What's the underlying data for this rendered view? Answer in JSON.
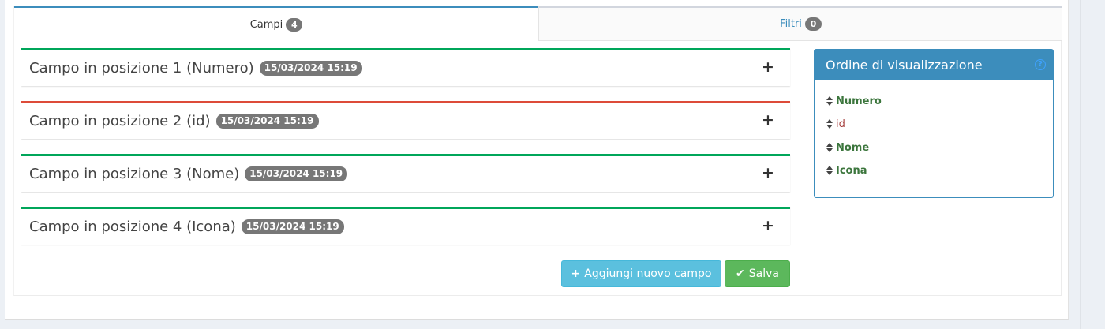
{
  "tabs": [
    {
      "label": "Campi",
      "count": "4"
    },
    {
      "label": "Filtri",
      "count": "0"
    }
  ],
  "fields": [
    {
      "title": "Campo in posizione 1 (Numero)",
      "date": "15/03/2024 15:19",
      "status_color": "#00a65a"
    },
    {
      "title": "Campo in posizione 2 (id)",
      "date": "15/03/2024 15:19",
      "status_color": "#dd4b39"
    },
    {
      "title": "Campo in posizione 3 (Nome)",
      "date": "15/03/2024 15:19",
      "status_color": "#00a65a"
    },
    {
      "title": "Campo in posizione 4 (Icona)",
      "date": "15/03/2024 15:19",
      "status_color": "#00a65a"
    }
  ],
  "buttons": {
    "add_label": "Aggiungi nuovo campo",
    "save_label": "Salva"
  },
  "order_panel": {
    "title": "Ordine di visualizzazione",
    "help_icon": "question-circle-icon",
    "items": [
      {
        "label": "Numero",
        "color": "#3c763d"
      },
      {
        "label": "id",
        "color": "#a94442"
      },
      {
        "label": "Nome",
        "color": "#3c763d"
      },
      {
        "label": "Icona",
        "color": "#3c763d"
      }
    ]
  },
  "colors": {
    "primary": "#3c8dbc",
    "success": "#00a65a",
    "danger": "#dd4b39",
    "info": "#5bc0de",
    "save": "#5cb85c"
  }
}
